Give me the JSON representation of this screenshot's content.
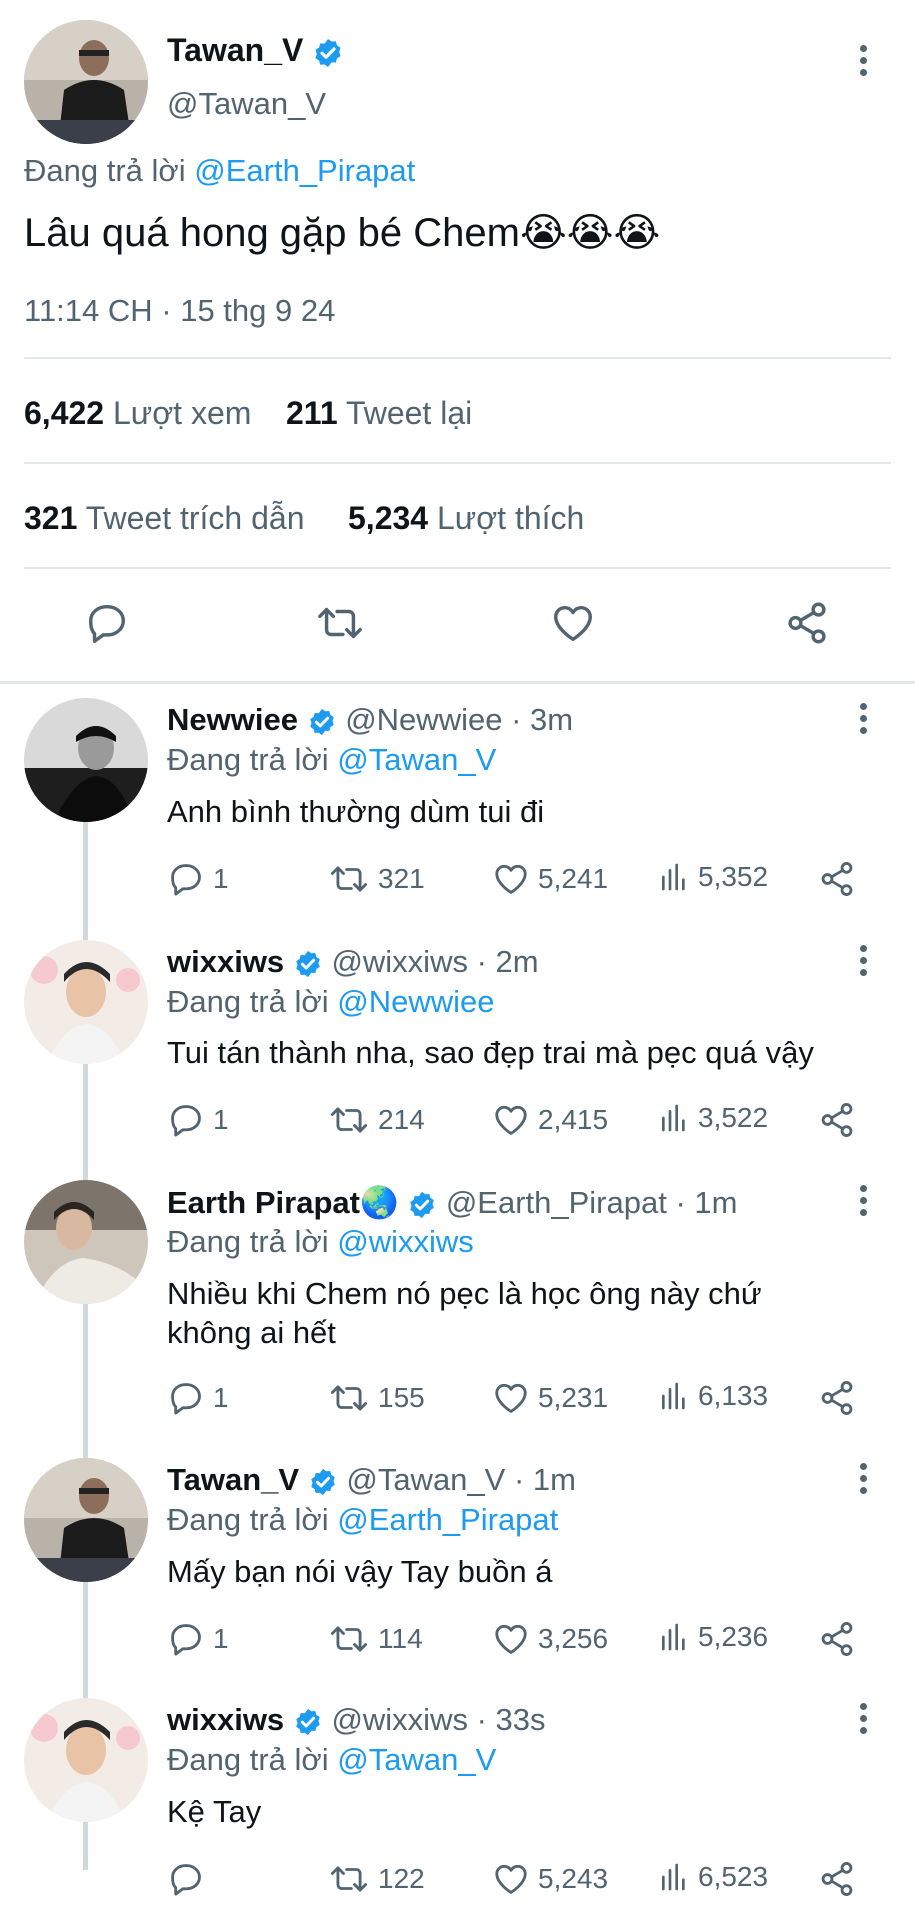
{
  "main_tweet": {
    "display_name": "Tawan_V",
    "handle": "@Tawan_V",
    "reply_prefix": "Đang trả lời",
    "reply_to": "@Earth_Pirapat",
    "text": "Lâu quá hong gặp bé Chem",
    "emoji": "😭😭😭",
    "timestamp": "11:14 CH · 15 thg 9 24",
    "stats": {
      "views_count": "6,422",
      "views_label": "Lượt xem",
      "retweets_count": "211",
      "retweets_label": "Tweet lại",
      "quotes_count": "321",
      "quotes_label": "Tweet trích dẫn",
      "likes_count": "5,234",
      "likes_label": "Lượt thích"
    },
    "actions": [
      "reply-icon",
      "retweet-icon",
      "like-icon",
      "share-icon"
    ]
  },
  "replies": [
    {
      "display_name": "Newwiee",
      "name_emoji": "",
      "handle": "@Newwiee",
      "time": "· 3m",
      "reply_prefix": "Đang trả lời",
      "reply_to": "@Tawan_V",
      "text": "Anh bình thường dùm tui đi",
      "replies": "1",
      "retweets": "321",
      "likes": "5,241",
      "views": "5,352"
    },
    {
      "display_name": "wixxiws",
      "name_emoji": "",
      "handle": "@wixxiws",
      "time": "· 2m",
      "reply_prefix": "Đang trả lời",
      "reply_to": "@Newwiee",
      "text": "Tui tán thành nha, sao đẹp trai mà pẹc quá vậy",
      "replies": "1",
      "retweets": "214",
      "likes": "2,415",
      "views": "3,522"
    },
    {
      "display_name": "Earth Pirapat",
      "name_emoji": "🌏",
      "handle": "@Earth_Pirapat",
      "time": "· 1m",
      "reply_prefix": "Đang trả lời",
      "reply_to": "@wixxiws",
      "text_line1": "Nhiều khi Chem nó pẹc là học ông này chứ",
      "text_line2": "không ai hết",
      "replies": "1",
      "retweets": "155",
      "likes": "5,231",
      "views": "6,133"
    },
    {
      "display_name": "Tawan_V",
      "name_emoji": "",
      "handle": "@Tawan_V",
      "time": "· 1m",
      "reply_prefix": "Đang trả lời",
      "reply_to": "@Earth_Pirapat",
      "text": "Mấy bạn nói vậy Tay buồn á",
      "replies": "1",
      "retweets": "114",
      "likes": "3,256",
      "views": "5,236"
    },
    {
      "display_name": "wixxiws",
      "name_emoji": "",
      "handle": "@wixxiws",
      "time": "· 33s",
      "reply_prefix": "Đang trả lời",
      "reply_to": "@Tawan_V",
      "text": "Kệ Tay",
      "replies": "",
      "retweets": "122",
      "likes": "5,243",
      "views": "6,523"
    }
  ],
  "colors": {
    "accent": "#1d9bf0",
    "secondary_text": "#536471",
    "divider": "#e4e8eb"
  }
}
